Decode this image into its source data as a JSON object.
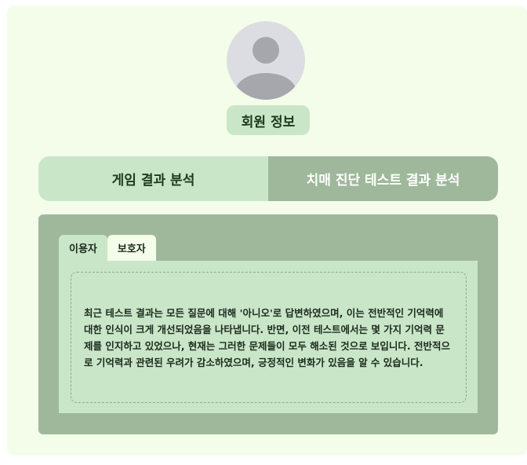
{
  "profile": {
    "avatar_icon": "user-silhouette-icon",
    "title": "회원 정보"
  },
  "main_tabs": [
    {
      "label": "게임 결과 분석",
      "active": true
    },
    {
      "label": "치매 진단 테스트 결과 분석",
      "active": false
    }
  ],
  "sub_tabs": [
    {
      "label": "이용자",
      "active": true
    },
    {
      "label": "보호자",
      "active": false
    }
  ],
  "result": {
    "text": "최근 테스트 결과는 모든 질문에 대해 '아니오'로 답변하였으며, 이는 전반적인 기억력에 대한 인식이 크게 개선되었음을 나타냅니다. 반면, 이전 테스트에서는 몇 가지 기억력 문제를 인지하고 있었으나, 현재는 그러한 문제들이 모두 해소된 것으로 보입니다. 전반적으로 기억력과 관련된 우려가 감소하였으며, 긍정적인 변화가 있음을 알 수 있습니다."
  },
  "colors": {
    "page_bg": "#f4fde9",
    "accent_light": "#c9e6c9",
    "accent_dark": "#9fb89c",
    "text": "#1d3a1d"
  }
}
